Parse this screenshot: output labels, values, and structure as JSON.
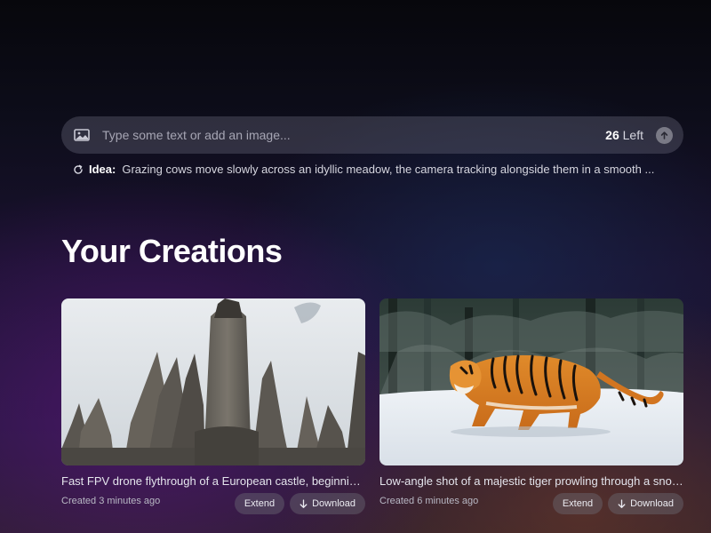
{
  "prompt": {
    "placeholder": "Type some text or add an image...",
    "value": "",
    "credits_count": "26",
    "credits_suffix": " Left",
    "icons": {
      "attach": "image-icon",
      "submit": "arrow-up-icon"
    }
  },
  "idea": {
    "icon": "refresh-icon",
    "label": "Idea:",
    "text": "Grazing cows move slowly across an idyllic meadow, the camera tracking alongside them in a smooth ..."
  },
  "section_title": "Your Creations",
  "creations": [
    {
      "title": "Fast FPV drone flythrough of a European castle, beginning from the ground and ascending",
      "created": "Created 3 minutes ago",
      "extend_label": "Extend",
      "download_label": "Download"
    },
    {
      "title": "Low-angle shot of a majestic tiger prowling through a snowy forest",
      "created": "Created 6 minutes ago",
      "extend_label": "Extend",
      "download_label": "Download"
    }
  ]
}
